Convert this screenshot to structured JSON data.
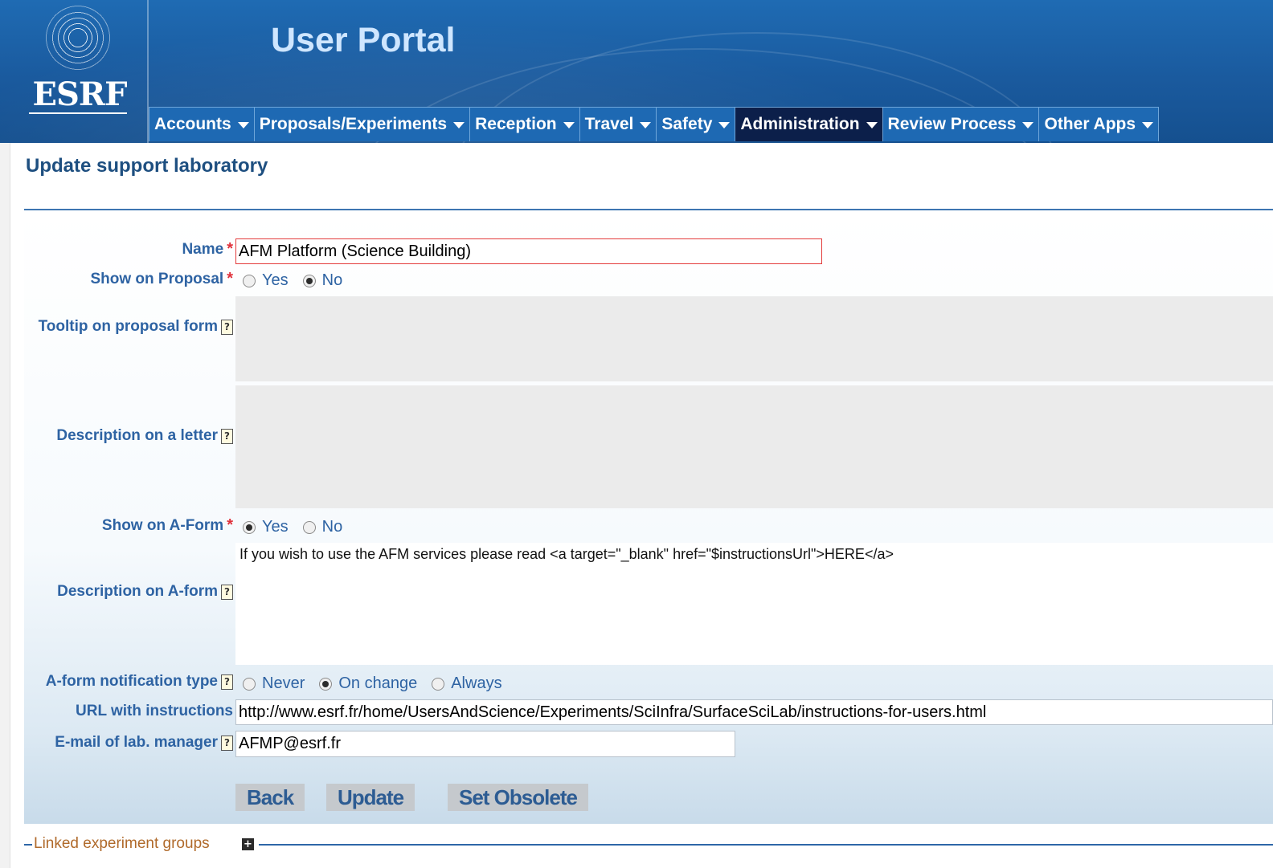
{
  "header": {
    "logo_text": "ESRF",
    "portal_title": "User Portal"
  },
  "nav": {
    "items": [
      {
        "label": "Accounts"
      },
      {
        "label": "Proposals/Experiments"
      },
      {
        "label": "Reception"
      },
      {
        "label": "Travel"
      },
      {
        "label": "Safety"
      },
      {
        "label": "Administration"
      },
      {
        "label": "Review Process"
      },
      {
        "label": "Other Apps"
      }
    ]
  },
  "page": {
    "title": "Update support laboratory"
  },
  "form": {
    "required_mark": "*",
    "help_mark": "?",
    "name": {
      "label": "Name",
      "value": "AFM Platform (Science Building)"
    },
    "show_on_proposal": {
      "label": "Show on Proposal",
      "options": [
        "Yes",
        "No"
      ],
      "selected": "No"
    },
    "tooltip": {
      "label": "Tooltip on proposal form",
      "value": ""
    },
    "description_letter": {
      "label": "Description on a letter",
      "value": ""
    },
    "show_on_aform": {
      "label": "Show on A-Form",
      "options": [
        "Yes",
        "No"
      ],
      "selected": "Yes"
    },
    "description_aform": {
      "label": "Description on A-form",
      "value": "If you wish to use the AFM services please read <a target=\"_blank\" href=\"$instructionsUrl\">HERE</a>"
    },
    "notification_type": {
      "label": "A-form notification type",
      "options": [
        "Never",
        "On change",
        "Always"
      ],
      "selected": "On change"
    },
    "url_instructions": {
      "label": "URL with instructions",
      "value": "http://www.esrf.fr/home/UsersAndScience/Experiments/SciInfra/SurfaceSciLab/instructions-for-users.html"
    },
    "email_manager": {
      "label": "E-mail of lab. manager",
      "value": "AFMP@esrf.fr"
    }
  },
  "buttons": {
    "back": "Back",
    "update": "Update",
    "set_obsolete": "Set Obsolete"
  },
  "linked_groups": {
    "label": "Linked experiment groups",
    "toggle": "+"
  },
  "colors": {
    "header_blue": "#1a5a9e",
    "nav_active": "#0c1f4a",
    "label_blue": "#2e63a3",
    "required_red": "#e0303a",
    "linked_label": "#b06a2b"
  }
}
